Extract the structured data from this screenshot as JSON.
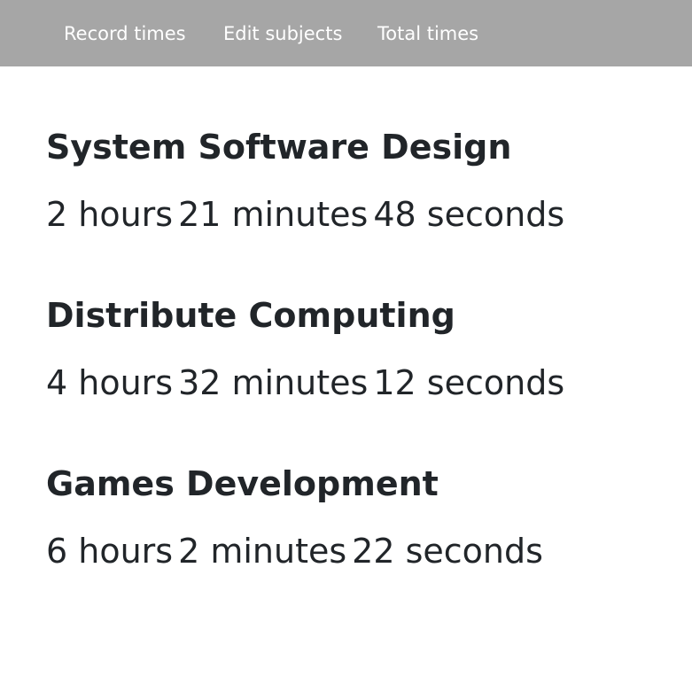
{
  "nav": {
    "items": [
      {
        "label": "Record times"
      },
      {
        "label": "Edit subjects"
      },
      {
        "label": "Total times"
      }
    ]
  },
  "subjects": [
    {
      "name": "System Software Design",
      "hours": "2 hours",
      "minutes": "21 minutes",
      "seconds": "48 seconds"
    },
    {
      "name": "Distribute Computing",
      "hours": "4 hours",
      "minutes": "32 minutes",
      "seconds": "12 seconds"
    },
    {
      "name": "Games Development",
      "hours": "6 hours",
      "minutes": "2 minutes",
      "seconds": "22 seconds"
    }
  ],
  "colors": {
    "navbar": "#a6a6a6",
    "nav_text": "#ffffff",
    "body_text": "#212529",
    "background": "#ffffff"
  }
}
